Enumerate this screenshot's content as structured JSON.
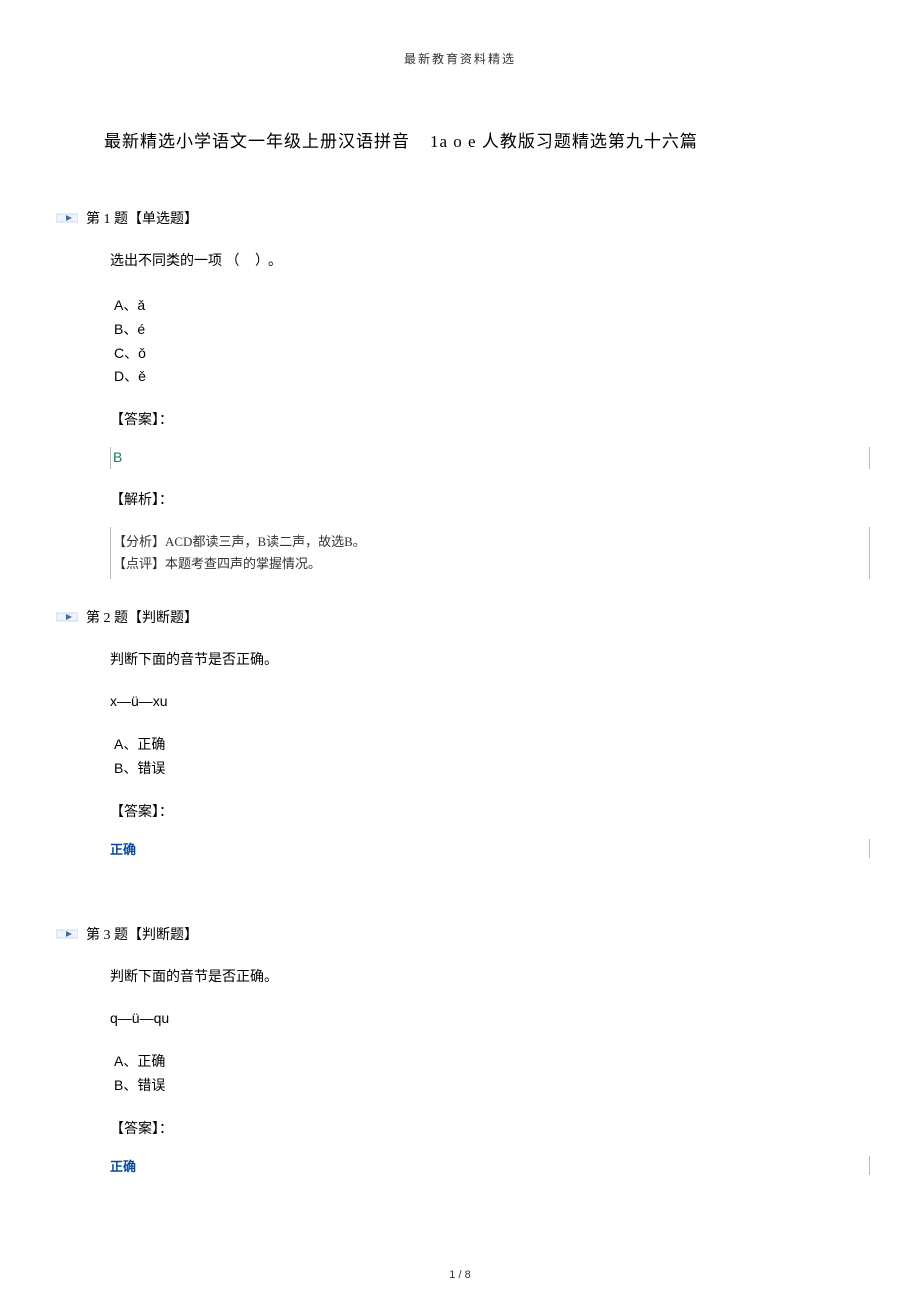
{
  "header": "最新教育资料精选",
  "title_part1": "最新精选小学语文一年级上册汉语拼音",
  "title_part2": "1a o e 人教版习题精选第九十六篇",
  "questions": [
    {
      "header": "第 1 题【单选题】",
      "prompt_pre": "选出不同类的一项",
      "prompt_paren": "（    ）。",
      "options": [
        {
          "label": "A、",
          "val": "ǎ"
        },
        {
          "label": "B、",
          "val": "é"
        },
        {
          "label": "C、",
          "val": "ǒ"
        },
        {
          "label": "D、",
          "val": "ě"
        }
      ],
      "answer_label": "【答案】：",
      "answer": "B",
      "analysis_label": "【解析】：",
      "analysis": [
        "【分析】ACD都读三声，B读二声，故选B。",
        "【点评】本题考查四声的掌握情况。"
      ]
    },
    {
      "header": "第 2 题【判断题】",
      "prompt": "判断下面的音节是否正确。",
      "syllable": "x—ü—xu",
      "options": [
        {
          "label": "A、",
          "val": "正确"
        },
        {
          "label": "B、",
          "val": "错误"
        }
      ],
      "answer_label": "【答案】：",
      "answer_badge": "正确"
    },
    {
      "header": "第 3 题【判断题】",
      "prompt": "判断下面的音节是否正确。",
      "syllable": "q—ü—qu",
      "options": [
        {
          "label": "A、",
          "val": "正确"
        },
        {
          "label": "B、",
          "val": "错误"
        }
      ],
      "answer_label": "【答案】：",
      "answer_badge": "正确"
    }
  ],
  "page_number": "1 / 8"
}
